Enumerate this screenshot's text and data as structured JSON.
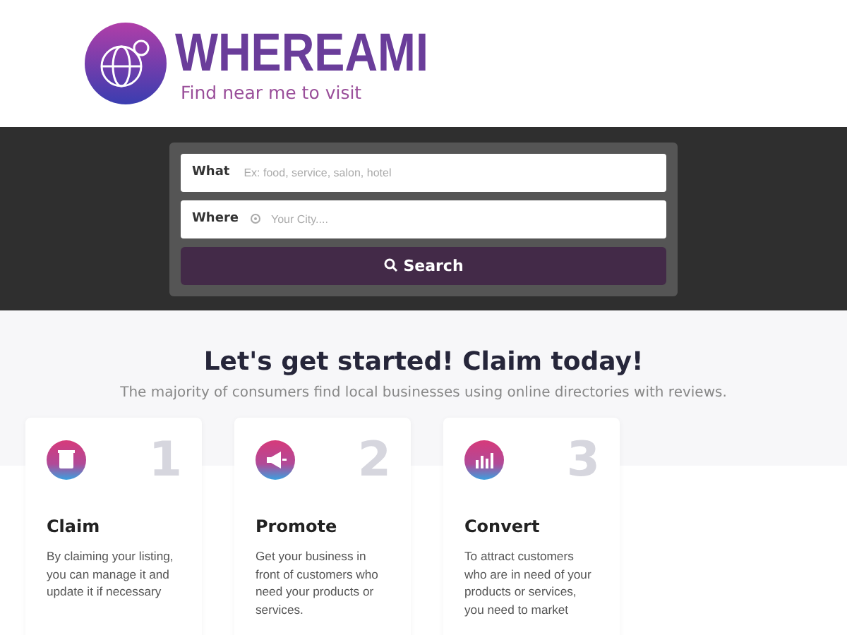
{
  "logo": {
    "name": "WHEREAMI",
    "tagline": "Find near me to visit"
  },
  "search": {
    "what_label": "What",
    "what_placeholder": "Ex: food, service, salon, hotel",
    "where_label": "Where",
    "where_placeholder": "Your City....",
    "button": "Search"
  },
  "intro": {
    "title": "Let's get started! Claim today!",
    "subtitle": "The majority of consumers find local businesses using online directories with reviews."
  },
  "steps": [
    {
      "kind": "document",
      "number": "1",
      "title": "Claim",
      "text": "By claiming your listing, you can manage it and update it if necessary"
    },
    {
      "kind": "megaphone",
      "number": "2",
      "title": "Promote",
      "text": "Get your business in front of customers who need your products or services."
    },
    {
      "kind": "chart",
      "number": "3",
      "title": "Convert",
      "text": "To attract customers who are in need of your products or services, you need to market"
    }
  ]
}
